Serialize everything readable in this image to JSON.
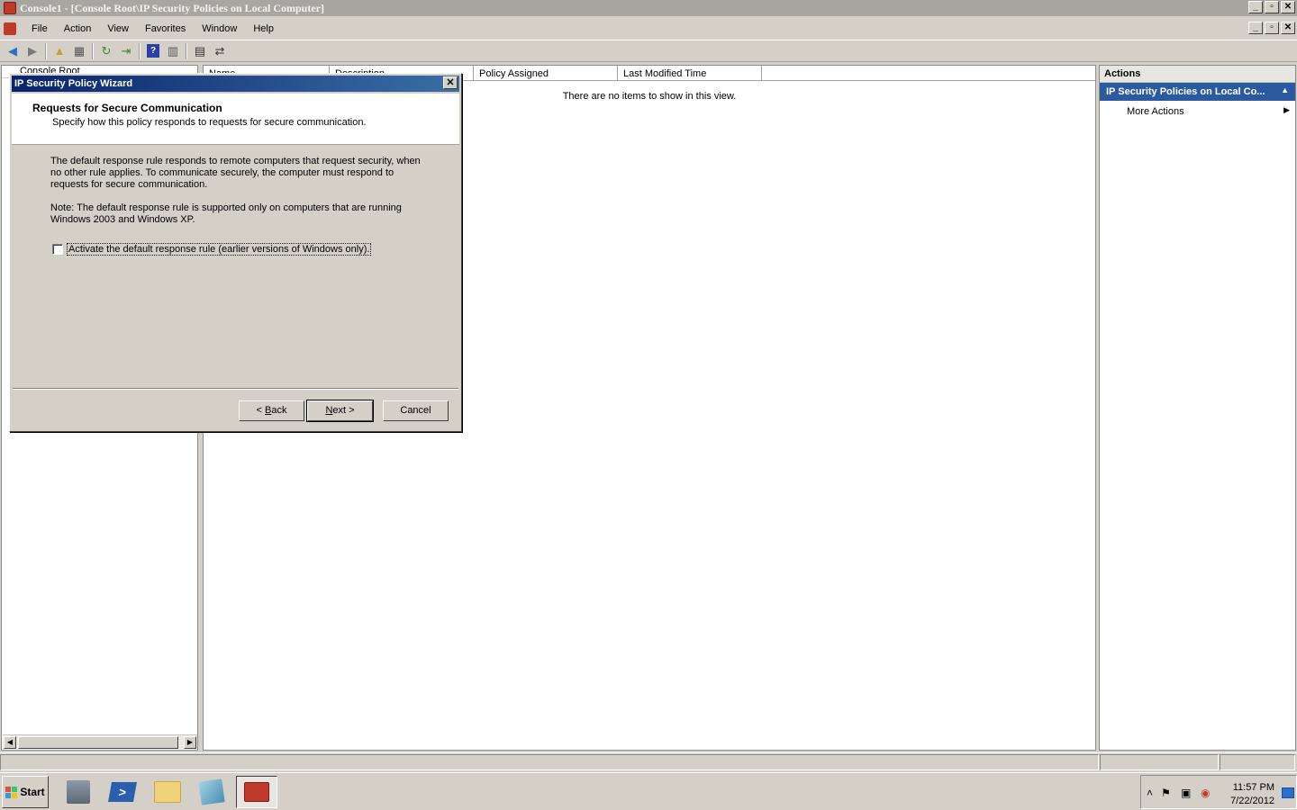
{
  "window": {
    "title": "Console1 - [Console Root\\IP Security Policies on Local Computer]",
    "minimize": "_",
    "maximize": "▫",
    "close": "✕"
  },
  "menu": [
    "File",
    "Action",
    "View",
    "Favorites",
    "Window",
    "Help"
  ],
  "toolbar": {
    "icons": [
      "back-icon",
      "forward-icon",
      "up-folder-icon",
      "show-hide-tree-icon",
      "refresh-icon",
      "export-list-icon",
      "help-icon",
      "show-hide-action-pane-icon",
      "properties-icon",
      "manage-filters-icon"
    ],
    "help_label": "?"
  },
  "tree": {
    "header": "Console Root"
  },
  "list": {
    "columns": [
      "Name",
      "Description",
      "Policy Assigned",
      "Last Modified Time"
    ],
    "empty_message": "There are no items to show in this view."
  },
  "actions": {
    "header": "Actions",
    "section_title": "IP Security Policies on Local Co...",
    "items": [
      "More Actions"
    ]
  },
  "wizard": {
    "title": "IP Security Policy Wizard",
    "heading": "Requests for Secure Communication",
    "subheading": "Specify how this policy responds to requests for secure communication.",
    "paragraph1": "The default response rule responds to remote computers that request security, when no other rule applies. To communicate securely, the computer must respond to requests for secure communication.",
    "paragraph2": "Note: The default response rule is supported only on computers that are running Windows 2003 and Windows XP.",
    "checkbox_label": "Activate the default response rule (earlier versions of Windows only).",
    "checkbox_checked": false,
    "back_button": "< Back",
    "next_button": "Next >",
    "cancel_button": "Cancel"
  },
  "taskbar": {
    "start": "Start",
    "apps": [
      "server-manager-icon",
      "powershell-icon",
      "explorer-folder-icon",
      "documents-icon",
      "mmc-console-icon"
    ],
    "active_app": "mmc-console-icon",
    "time": "11:57 PM",
    "date": "7/22/2012"
  }
}
